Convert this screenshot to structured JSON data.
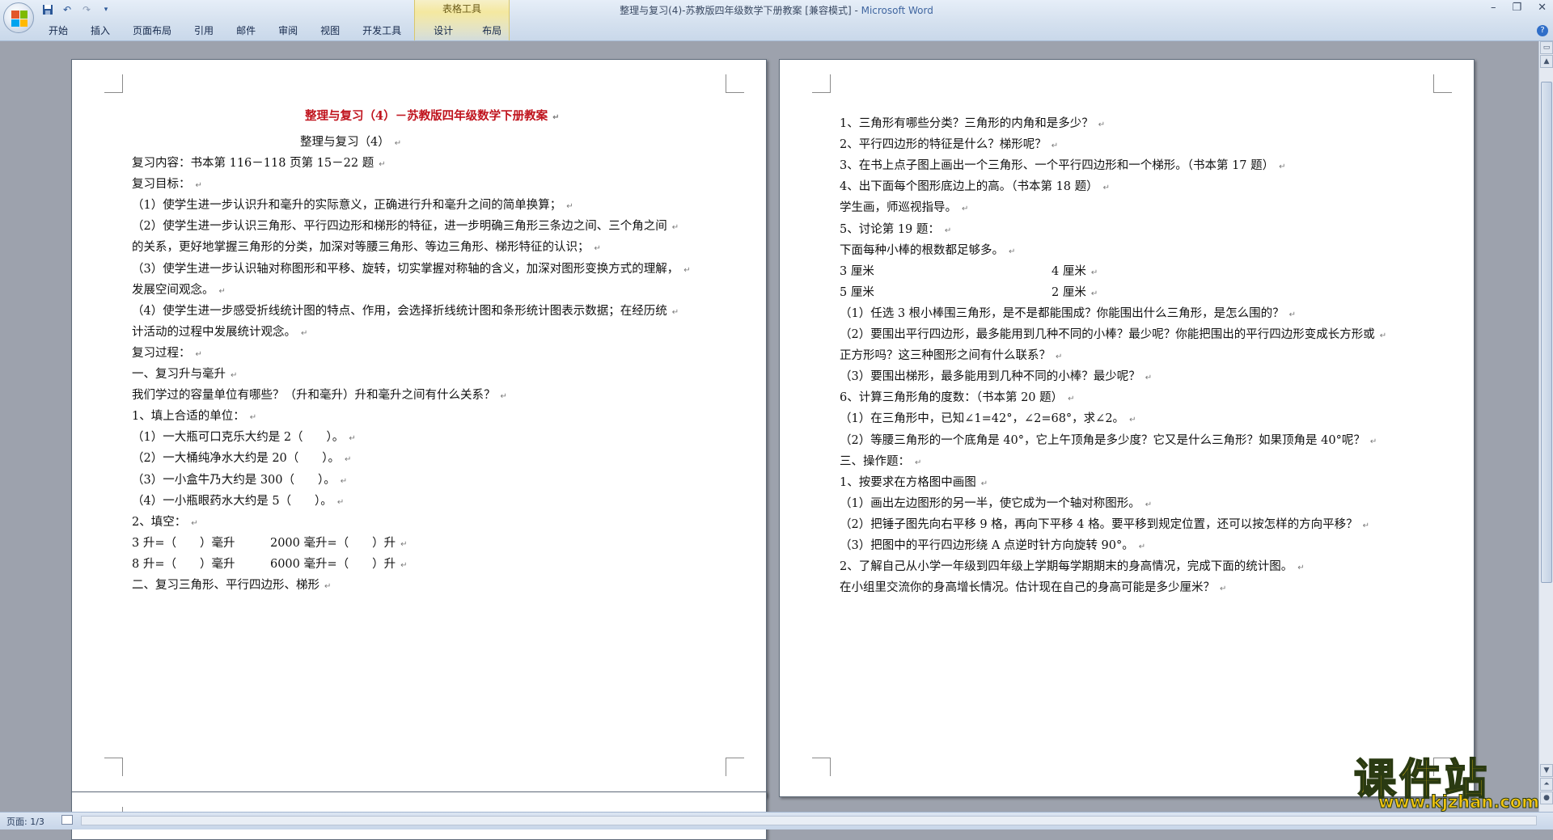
{
  "window": {
    "title": "整理与复习(4)-苏教版四年级数学下册教案 [兼容模式] - ",
    "app_name": "Microsoft Word",
    "controls": [
      "–",
      "❐",
      "✕"
    ]
  },
  "quick_access": [
    "save-icon",
    "undo-icon",
    "redo-icon",
    "customize-icon"
  ],
  "context_tab_group": "表格工具",
  "ribbon_tabs": [
    "开始",
    "插入",
    "页面布局",
    "引用",
    "邮件",
    "审阅",
    "视图",
    "开发工具",
    "设计",
    "布局"
  ],
  "page1": {
    "lines": [
      "整理与复习（4）－苏教版四年级数学下册教案",
      "整理与复习（4）",
      "复习内容：书本第 116－118 页第 15－22 题",
      "复习目标：",
      "（1）使学生进一步认识升和毫升的实际意义，正确进行升和毫升之间的简单换算；",
      "（2）使学生进一步认识三角形、平行四边形和梯形的特征，进一步明确三角形三条边之间、三个角之间",
      "的关系，更好地掌握三角形的分类，加深对等腰三角形、等边三角形、梯形特征的认识；",
      "（3）使学生进一步认识轴对称图形和平移、旋转，切实掌握对称轴的含义，加深对图形变换方式的理解，",
      "发展空间观念。",
      "（4）使学生进一步感受折线统计图的特点、作用，会选择折线统计图和条形统计图表示数据；在经历统",
      "计活动的过程中发展统计观念。",
      "复习过程：",
      "一、复习升与毫升",
      "我们学过的容量单位有哪些？（升和毫升）升和毫升之间有什么关系？",
      "1、填上合适的单位：",
      "（1）一大瓶可口克乐大约是 2（　　）。",
      "（2）一大桶纯净水大约是 20（　　）。",
      "（3）一小盒牛乃大约是 300（　　）。",
      "（4）一小瓶眼药水大约是 5（　　）。",
      "2、填空：",
      "3 升=（　　）毫升　　　2000 毫升=（　　）升",
      "8 升=（　　）毫升　　　6000 毫升=（　　）升",
      "二、复习三角形、平行四边形、梯形"
    ]
  },
  "page2": {
    "lines": [
      "1、三角形有哪些分类？三角形的内角和是多少？",
      "2、平行四边形的特征是什么？梯形呢？",
      "3、在书上点子图上画出一个三角形、一个平行四边形和一个梯形。（书本第 17 题）",
      "4、出下面每个图形底边上的高。（书本第 18 题）",
      "学生画，师巡视指导。",
      "5、讨论第 19 题：",
      "下面每种小棒的根数都足够多。",
      "3 厘米",
      "4 厘米",
      "5 厘米",
      "2 厘米",
      "（1）任选 3 根小棒围三角形，是不是都能围成？你能围出什么三角形，是怎么围的？",
      "（2）要围出平行四边形，最多能用到几种不同的小棒？最少呢？你能把围出的平行四边形变成长方形或",
      "正方形吗？这三种图形之间有什么联系？",
      "（3）要围出梯形，最多能用到几种不同的小棒？最少呢？",
      "6、计算三角形角的度数：（书本第 20 题）",
      "（1）在三角形中，已知∠1=42°，∠2=68°，求∠2。",
      "（2）等腰三角形的一个底角是 40°，它上午顶角是多少度？它又是什么三角形？如果顶角是 40°呢？",
      "三、操作题：",
      "1、按要求在方格图中画图",
      "（1）画出左边图形的另一半，使它成为一个轴对称图形。",
      "（2）把锤子图先向右平移 9 格，再向下平移 4 格。要平移到规定位置，还可以按怎样的方向平移？",
      "（3）把图中的平行四边形绕 A 点逆时针方向旋转 90°。",
      "2、了解自己从小学一年级到四年级上学期每学期期末的身高情况，完成下面的统计图。",
      "在小组里交流你的身高增长情况。估计现在自己的身高可能是多少厘米？"
    ]
  },
  "paragraph_mark": "↵",
  "status": {
    "page_info": "页面: 1/3"
  },
  "watermark": {
    "text": "课件站",
    "url": "www.kjzhan.com"
  },
  "colors": {
    "title_red": "#c0141e",
    "accent_blue": "#2b5797",
    "watermark_yellow": "#f2c50f"
  }
}
